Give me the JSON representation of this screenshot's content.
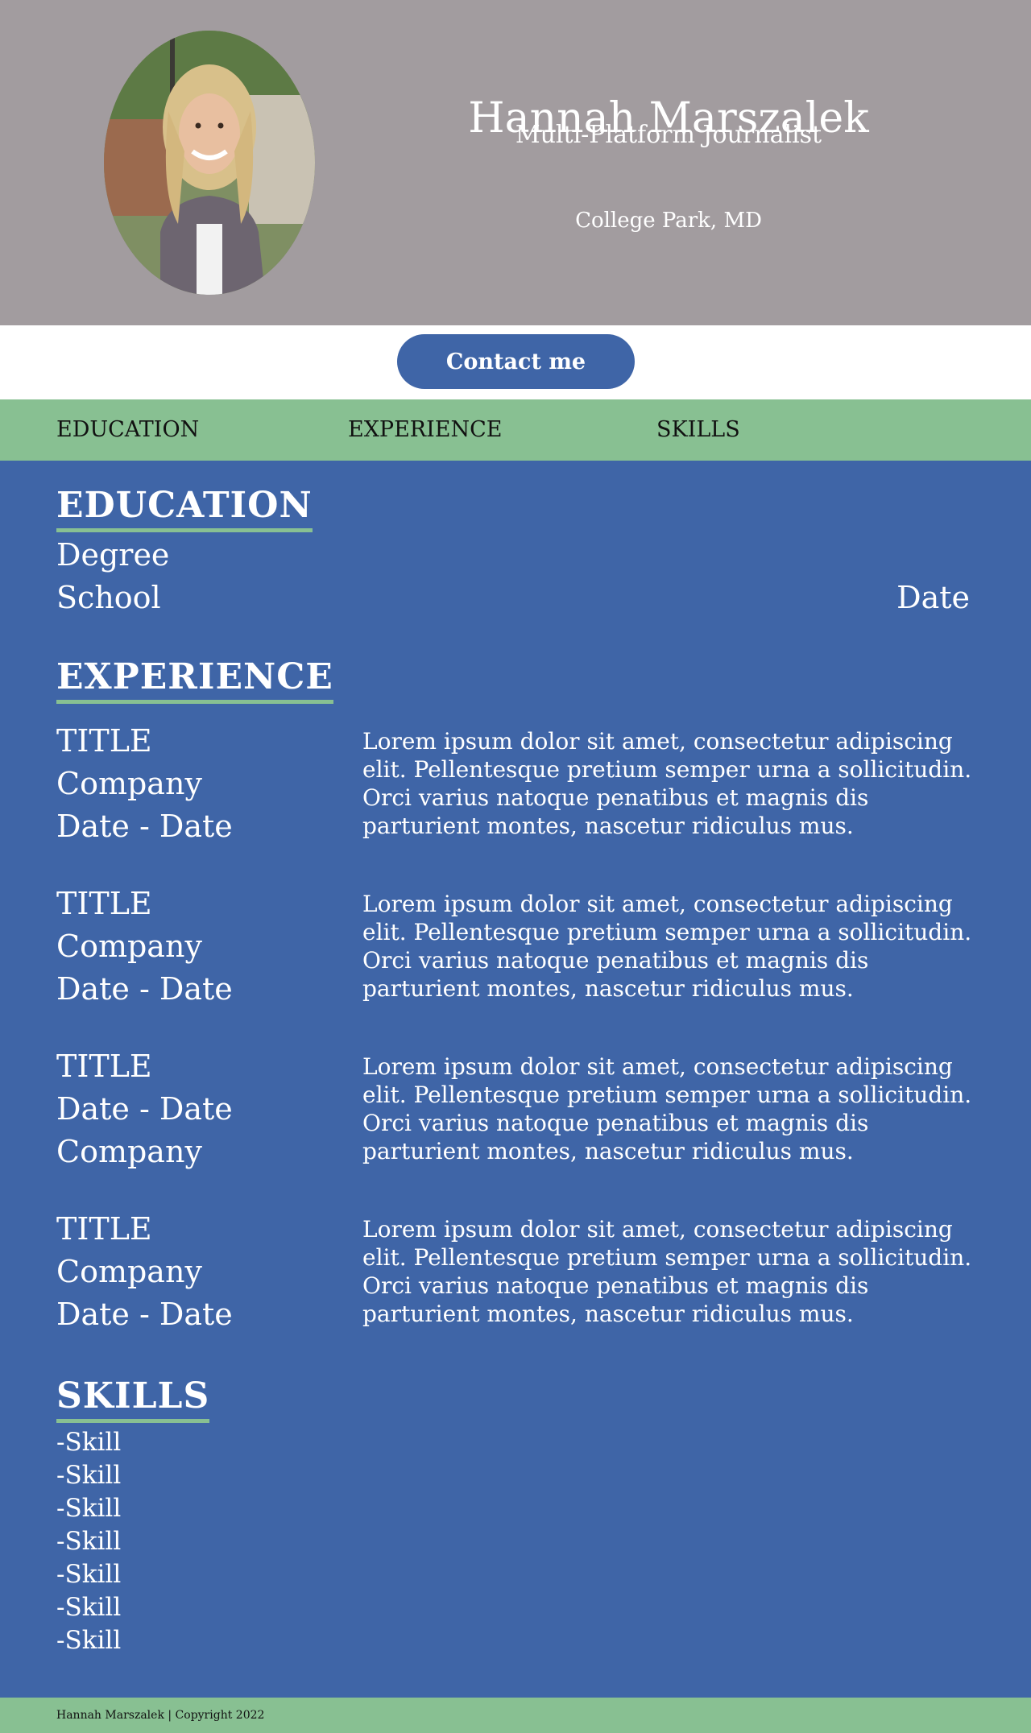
{
  "header": {
    "name": "Hannah Marszalek",
    "role": "Multi-Platform Journalist",
    "location": "College Park, MD",
    "background_color": "#a29c9f"
  },
  "contact": {
    "button_label": "Contact me"
  },
  "nav": {
    "items": [
      "EDUCATION",
      "EXPERIENCE",
      "SKILLS"
    ],
    "background_color": "#88c092"
  },
  "education": {
    "title": "EDUCATION",
    "degree": "Degree",
    "school": "School",
    "date": "Date"
  },
  "experience": {
    "title": "EXPERIENCE",
    "entries": [
      {
        "lines": [
          "TITLE",
          "Company",
          "Date - Date"
        ],
        "description": "Lorem ipsum dolor sit amet, consectetur adipiscing elit. Pellentesque pretium semper urna a sollicitudin. Orci varius natoque penatibus et magnis dis parturient montes, nascetur ridiculus mus."
      },
      {
        "lines": [
          "TITLE",
          "Company",
          "Date - Date"
        ],
        "description": "Lorem ipsum dolor sit amet, consectetur adipiscing elit. Pellentesque pretium semper urna a sollicitudin. Orci varius natoque penatibus et magnis dis parturient montes, nascetur ridiculus mus."
      },
      {
        "lines": [
          "TITLE",
          "Date - Date",
          "Company"
        ],
        "description": "Lorem ipsum dolor sit amet, consectetur adipiscing elit. Pellentesque pretium semper urna a sollicitudin. Orci varius natoque penatibus et magnis dis parturient montes, nascetur ridiculus mus."
      },
      {
        "lines": [
          "TITLE",
          "Company",
          "Date - Date"
        ],
        "description": "Lorem ipsum dolor sit amet, consectetur adipiscing elit. Pellentesque pretium semper urna a sollicitudin. Orci varius natoque penatibus et magnis dis parturient montes, nascetur ridiculus mus."
      }
    ]
  },
  "skills": {
    "title": "SKILLS",
    "items": [
      "-Skill",
      "-Skill",
      "-Skill",
      "-Skill",
      "-Skill",
      "-Skill",
      "-Skill"
    ]
  },
  "footer": {
    "text": "Hannah Marszalek | Copyright 2022"
  },
  "colors": {
    "main_background": "#3f65a7",
    "accent_green": "#88c092",
    "button": "#3f65a7"
  },
  "icons": {
    "profile_photo": "profile-photo"
  }
}
